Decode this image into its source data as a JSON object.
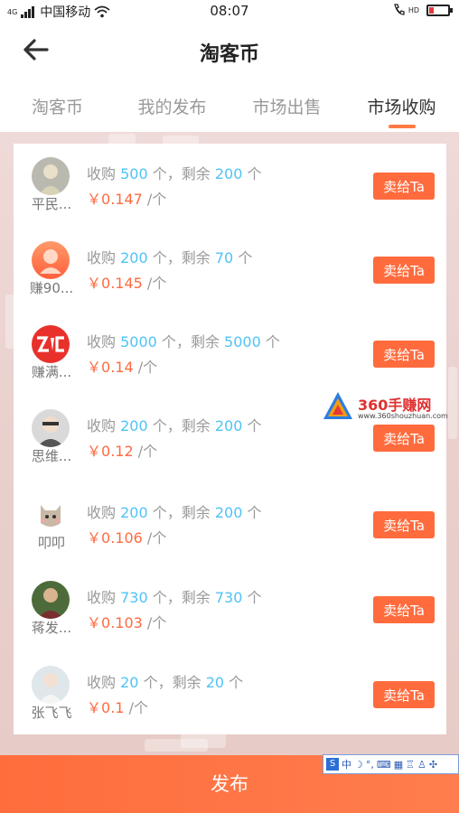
{
  "status_bar": {
    "carrier": "中国移动",
    "network_tag": "4G",
    "hd_tag": "HD",
    "time": "08:07"
  },
  "header": {
    "title": "淘客币",
    "back_icon": "arrow-left-icon"
  },
  "tabs": [
    {
      "label": "淘客币",
      "active": false
    },
    {
      "label": "我的发布",
      "active": false
    },
    {
      "label": "市场出售",
      "active": false
    },
    {
      "label": "市场收购",
      "active": true
    }
  ],
  "listing_labels": {
    "buy": "收购",
    "unit": "个",
    "remaining": "，剩余",
    "currency": "￥",
    "per": "/个"
  },
  "listings": [
    {
      "user": "平民...",
      "buy_count": "500",
      "remaining": "200",
      "price": "0.147",
      "action": "卖给Ta"
    },
    {
      "user": "赚90...",
      "buy_count": "200",
      "remaining": "70",
      "price": "0.145",
      "action": "卖给Ta"
    },
    {
      "user": "赚满...",
      "buy_count": "5000",
      "remaining": "5000",
      "price": "0.14",
      "action": "卖给Ta"
    },
    {
      "user": "思维...",
      "buy_count": "200",
      "remaining": "200",
      "price": "0.12",
      "action": "卖给Ta"
    },
    {
      "user": "叩叩",
      "buy_count": "200",
      "remaining": "200",
      "price": "0.106",
      "action": "卖给Ta"
    },
    {
      "user": "蒋发...",
      "buy_count": "730",
      "remaining": "730",
      "price": "0.103",
      "action": "卖给Ta"
    },
    {
      "user": "张飞飞",
      "buy_count": "20",
      "remaining": "20",
      "price": "0.1",
      "action": "卖给Ta"
    }
  ],
  "watermark": {
    "brand": "360手赚网",
    "url": "www.360shouzhuan.com"
  },
  "ime_bar": {
    "logo": "S",
    "mode": "中"
  },
  "footer": {
    "publish_label": "发布"
  },
  "colors": {
    "accent": "#ff6b3d",
    "number": "#4fc3f7",
    "price": "#ff6a40"
  }
}
